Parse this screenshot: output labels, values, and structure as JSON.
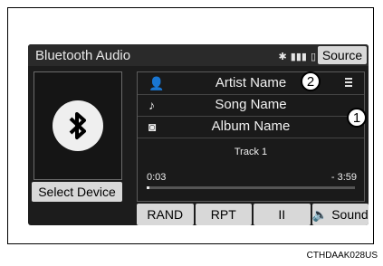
{
  "screen": {
    "title": "Bluetooth Audio",
    "source_label": "Source",
    "select_device_label": "Select Device",
    "artist": "Artist Name",
    "song": "Song Name",
    "album": "Album Name",
    "track": "Track 1",
    "time_elapsed": "0:03",
    "time_total": "- 3:59",
    "progress": 0.013,
    "buttons": [
      "RAND",
      "RPT",
      "II",
      "Sound"
    ]
  },
  "callouts": {
    "c1": "1",
    "c2": "2"
  },
  "doc_code": "CTHDAAK028US",
  "icons": {
    "artist": "person-icon",
    "song": "music-note-icon",
    "album": "album-icon",
    "bluetooth": "bluetooth-icon",
    "menu": "menu-icon",
    "speaker": "speaker-icon"
  }
}
